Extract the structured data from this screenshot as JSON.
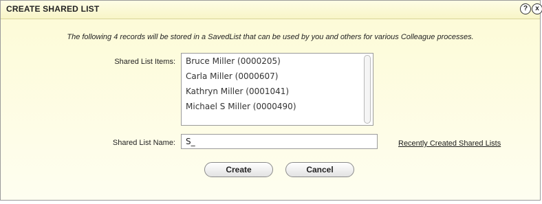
{
  "dialog": {
    "title": "CREATE SHARED LIST",
    "help_glyph": "?",
    "close_glyph": "x",
    "info_text": "The following 4 records will be stored in a SavedList that can be used by you and others for various Colleague processes.",
    "items_label": "Shared List Items:",
    "items": [
      "Bruce  Miller (0000205)",
      "Carla  Miller (0000607)",
      "Kathryn  Miller (0001041)",
      "Michael S Miller (0000490)"
    ],
    "name_label": "Shared List Name:",
    "name_value": "S_",
    "recent_link": "Recently Created Shared Lists",
    "create_label": "Create",
    "cancel_label": "Cancel"
  }
}
